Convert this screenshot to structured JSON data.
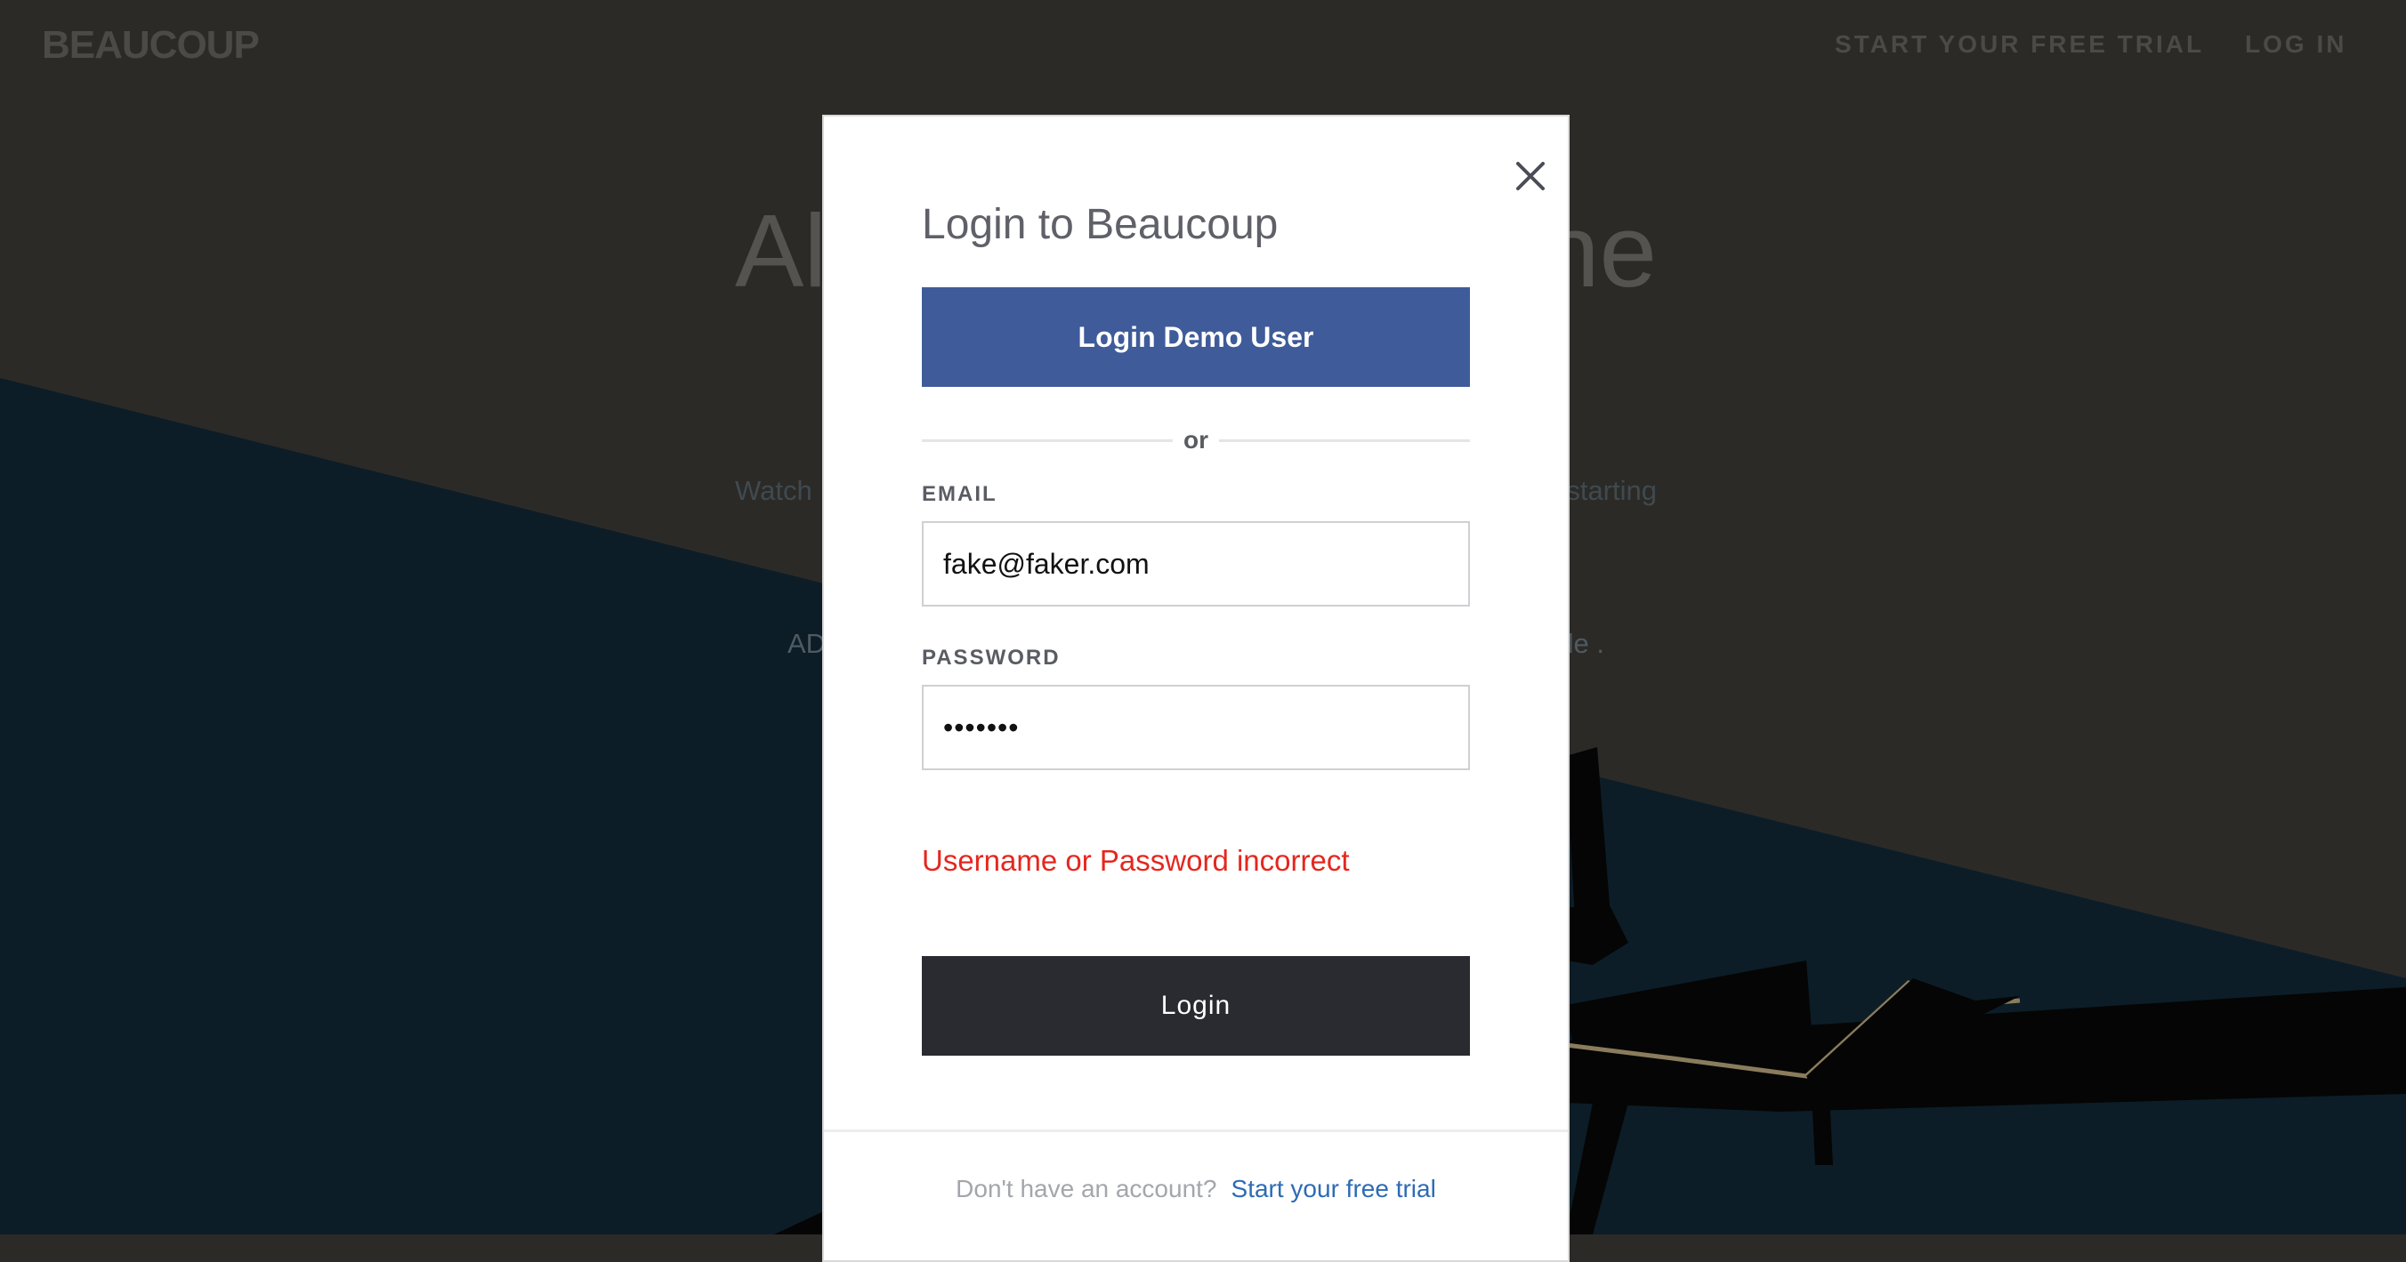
{
  "nav": {
    "logo": "BEAUCOUP",
    "trial_link": "START YOUR FREE TRIAL",
    "login_link": "LOG IN"
  },
  "hero": {
    "title_left": "Al",
    "title_right": "ne",
    "subtitle_left": "Watch",
    "subtitle_right": "starting",
    "cta_left": "AD",
    "cta_right": "le ."
  },
  "modal": {
    "title": "Login to Beaucoup",
    "demo_button": "Login Demo User",
    "divider_text": "or",
    "email_label": "EMAIL",
    "email_value": "fake@faker.com",
    "password_label": "PASSWORD",
    "password_value": "•••••••",
    "error": "Username or Password incorrect",
    "login_button": "Login",
    "footer_question": "Don't have an account?",
    "footer_link": "Start your free trial"
  },
  "colors": {
    "demo_button": "#3f5b99",
    "login_button": "#2a2b31",
    "error": "#e5271e",
    "link": "#2d6bb5"
  }
}
